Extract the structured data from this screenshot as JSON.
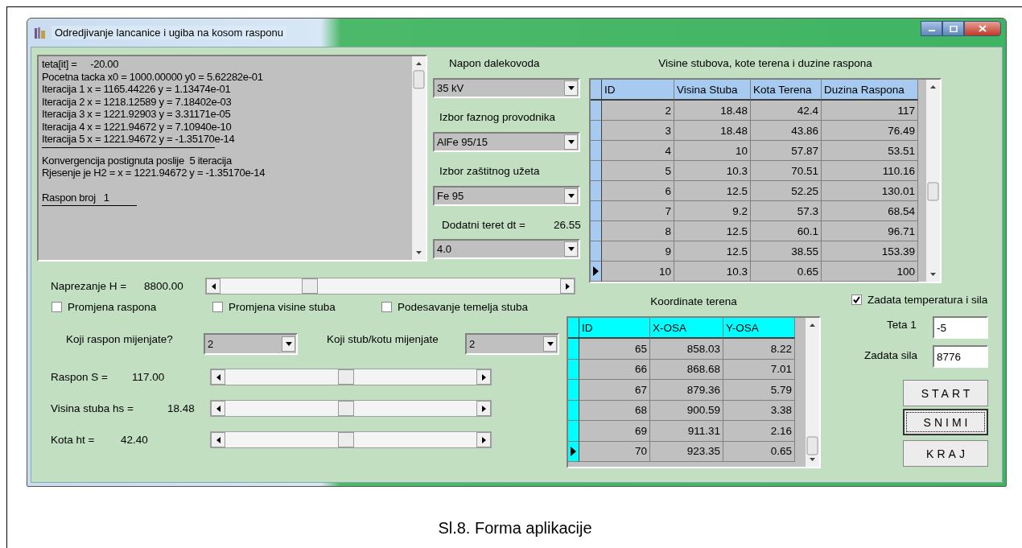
{
  "window": {
    "title": "Odredjivanje lancanice i ugiba na kosom rasponu"
  },
  "log": {
    "lines": [
      {
        "kind": "text",
        "text": "teta[it] =     -20.00"
      },
      {
        "kind": "text",
        "text": "Pocetna tacka x0 = 1000.00000 y0 = 5.62282e-01"
      },
      {
        "kind": "text",
        "text": "Iteracija 1 x = 1165.44226 y = 1.13474e-01"
      },
      {
        "kind": "text",
        "text": "Iteracija 2 x = 1218.12589 y = 7.18402e-03"
      },
      {
        "kind": "text",
        "text": "Iteracija 3 x = 1221.92903 y = 3.31171e-05"
      },
      {
        "kind": "text",
        "text": "Iteracija 4 x = 1221.94672 y = 7.10940e-10"
      },
      {
        "kind": "text",
        "text": "Iteracija 5 x = 1221.94672 y = -1.35170e-14"
      },
      {
        "kind": "rule"
      },
      {
        "kind": "text",
        "text": "Konvergencija postignuta poslije  5 iteracija"
      },
      {
        "kind": "text",
        "text": "Rjesenje je H2 = x = 1221.94672 y = -1.35170e-14"
      },
      {
        "kind": "blank"
      },
      {
        "kind": "text",
        "text": "Raspon broj   1"
      },
      {
        "kind": "rule"
      }
    ]
  },
  "combos": [
    {
      "label": "Napon dalekovoda",
      "value": "35 kV"
    },
    {
      "label": "Izbor faznog provodnika",
      "value": "AlFe 95/15"
    },
    {
      "label": "Izbor zaštitnog užeta",
      "value": "Fe 95"
    },
    {
      "label": "Dodatni teret dt =",
      "reading": "26.55",
      "value": "4.0"
    }
  ],
  "tables": [
    {
      "title": "Visine stubova, kote terena i duzine raspona",
      "columns": [
        "ID",
        "Visina Stuba",
        "Kota Terena",
        "Duzina Raspona"
      ],
      "rows": [
        {
          "current": false,
          "cells": [
            "2",
            "18.48",
            "42.4",
            "117"
          ]
        },
        {
          "current": false,
          "cells": [
            "3",
            "18.48",
            "43.86",
            "76.49"
          ]
        },
        {
          "current": false,
          "cells": [
            "4",
            "10",
            "57.87",
            "53.51"
          ]
        },
        {
          "current": false,
          "cells": [
            "5",
            "10.3",
            "70.51",
            "110.16"
          ]
        },
        {
          "current": false,
          "cells": [
            "6",
            "12.5",
            "52.25",
            "130.01"
          ]
        },
        {
          "current": false,
          "cells": [
            "7",
            "9.2",
            "57.3",
            "68.54"
          ]
        },
        {
          "current": false,
          "cells": [
            "8",
            "12.5",
            "60.1",
            "96.71"
          ]
        },
        {
          "current": false,
          "cells": [
            "9",
            "12.5",
            "38.55",
            "153.39"
          ]
        },
        {
          "current": true,
          "cells": [
            "10",
            "10.3",
            "0.65",
            "100"
          ]
        }
      ]
    },
    {
      "title": "Koordinate terena",
      "columns": [
        "ID",
        "X-OSA",
        "Y-OSA"
      ],
      "rows": [
        {
          "current": false,
          "cells": [
            "65",
            "858.03",
            "8.22"
          ]
        },
        {
          "current": false,
          "cells": [
            "66",
            "868.68",
            "7.01"
          ]
        },
        {
          "current": false,
          "cells": [
            "67",
            "879.36",
            "5.79"
          ]
        },
        {
          "current": false,
          "cells": [
            "68",
            "900.59",
            "3.38"
          ]
        },
        {
          "current": false,
          "cells": [
            "69",
            "911.31",
            "2.16"
          ]
        },
        {
          "current": true,
          "cells": [
            "70",
            "923.35",
            "0.65"
          ]
        }
      ]
    }
  ],
  "sliders": [
    {
      "label": "Naprezanje H =",
      "reading": "8800.00",
      "level": 0.26
    },
    {
      "label": "Raspon S =",
      "reading": "117.00",
      "level": 0.5
    },
    {
      "label": "Visina stuba hs =",
      "reading": "18.48",
      "level": 0.5
    },
    {
      "label": "Kota ht =",
      "reading": "42.40",
      "level": 0.5
    }
  ],
  "checkboxes": [
    {
      "label": "Promjena raspona",
      "checked": false
    },
    {
      "label": "Promjena visine stuba",
      "checked": false
    },
    {
      "label": "Podesavanje temelja stuba",
      "checked": false
    },
    {
      "label": "Zadata temperatura i sila",
      "checked": true
    }
  ],
  "pickers": [
    {
      "label": "Koji raspon mijenjate?",
      "value": "2"
    },
    {
      "label": "Koji stub/kotu mijenjate",
      "value": "2"
    }
  ],
  "fields": [
    {
      "label": "Teta 1",
      "value": "-5"
    },
    {
      "label": "Zadata sila",
      "value": "8776"
    }
  ],
  "buttons": [
    {
      "label": "START",
      "focused": false
    },
    {
      "label": "SNIMI",
      "focused": true
    },
    {
      "label": "KRAJ",
      "focused": false
    }
  ],
  "caption": "Sl.8. Forma aplikacije"
}
